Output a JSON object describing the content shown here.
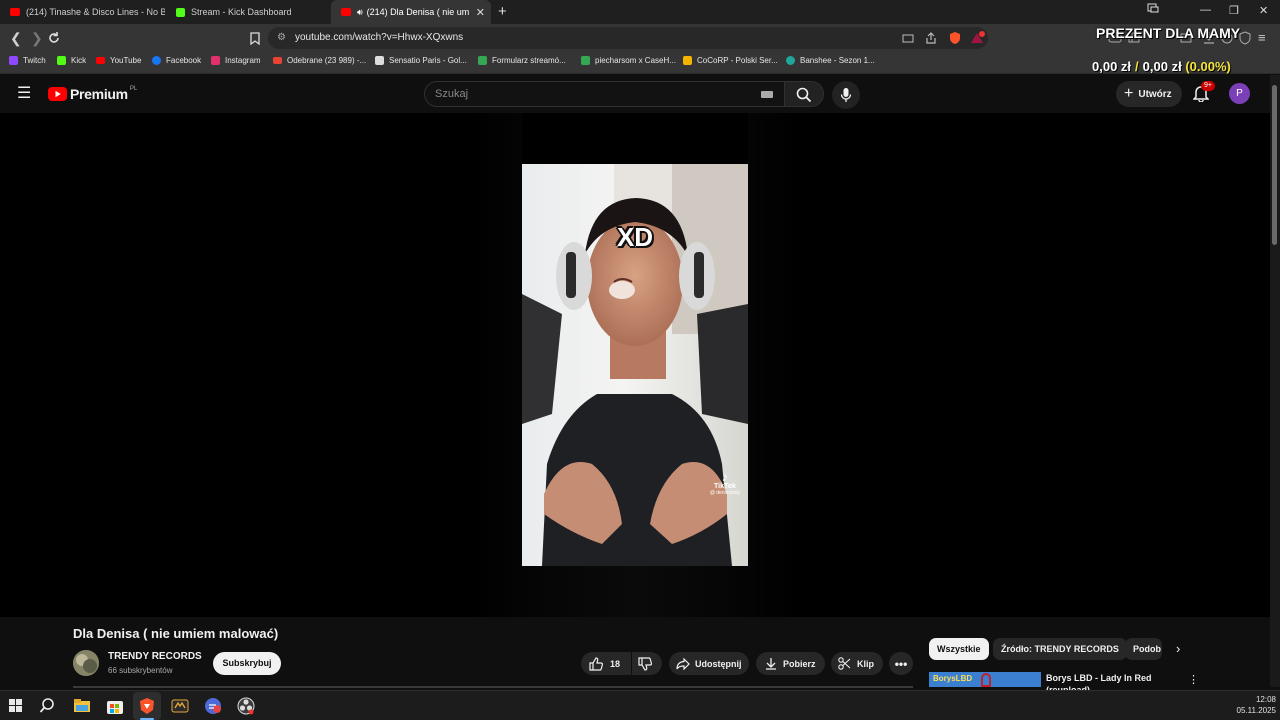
{
  "browser": {
    "tabs": [
      {
        "label": "(214) Tinashe & Disco Lines - No Bro",
        "icon": "youtube-icon",
        "active": false
      },
      {
        "label": "Stream - Kick Dashboard",
        "icon": "kick-icon",
        "active": false
      },
      {
        "label": "(214) Dla Denisa ( nie umiem",
        "icon": "youtube-icon",
        "active": true
      }
    ],
    "new_tab": "+",
    "url": "youtube.com/watch?v=Hhwx-XQxwns",
    "bookmarks": [
      {
        "label": "Twitch",
        "color": "#9146ff"
      },
      {
        "label": "Kick",
        "color": "#53fc18"
      },
      {
        "label": "YouTube",
        "color": "#ff0000"
      },
      {
        "label": "Facebook",
        "color": "#1877f2"
      },
      {
        "label": "Instagram",
        "color": "#e1306c"
      },
      {
        "label": "Odebrane (23 989) -...",
        "color": "#ea4335"
      },
      {
        "label": "Sensatio Paris - Gol...",
        "color": "#dddddd"
      },
      {
        "label": "Formularz streamó...",
        "color": "#34a853"
      },
      {
        "label": "piecharsom x CaseH...",
        "color": "#34a853"
      },
      {
        "label": "CoCoRP - Polski Ser...",
        "color": "#f4b400"
      },
      {
        "label": "Banshee - Sezon 1...",
        "color": "#1fa89a"
      }
    ]
  },
  "overlay": {
    "title": "PREZENT DLA MAMY",
    "amount_current": "0,00 zł",
    "separator": "/",
    "amount_goal": "0,00 zł",
    "percent": "(0.00%)"
  },
  "youtube": {
    "logo_label": "Premium",
    "logo_region": "PL",
    "search_placeholder": "Szukaj",
    "create_label": "Utwórz",
    "notifications_badge": "9+",
    "avatar_letter": "P"
  },
  "video": {
    "overlay_text": "XD",
    "watermark_brand": "TikTok",
    "watermark_user": "@ denisshoty",
    "title": "Dla Denisa ( nie umiem malować)",
    "channel_name": "TRENDY RECORDS",
    "channel_subs": "66 subskrybentów",
    "subscribe_label": "Subskrybuj",
    "like_count": "18",
    "share_label": "Udostępnij",
    "download_label": "Pobierz",
    "clip_label": "Klip"
  },
  "sidebar": {
    "chips": [
      "Wszystkie",
      "Źródło: TRENDY RECORDS",
      "Podob"
    ],
    "next_video_title": "Borys LBD - Lady In Red (reupload)",
    "next_video_thumb_text": "BorysLBD"
  },
  "taskbar": {
    "time": "12:08",
    "date": "05.11.2025"
  }
}
